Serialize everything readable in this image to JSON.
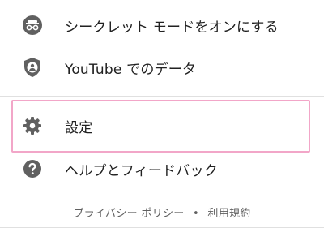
{
  "menu": {
    "items": [
      {
        "label": "シークレット モードをオンにする",
        "icon": "incognito-icon"
      },
      {
        "label": "YouTube でのデータ",
        "icon": "shield-person-icon"
      },
      {
        "label": "設定",
        "icon": "gear-icon"
      },
      {
        "label": "ヘルプとフィードバック",
        "icon": "help-icon"
      }
    ]
  },
  "footer": {
    "privacy_label": "プライバシー ポリシー",
    "separator": "•",
    "terms_label": "利用規約"
  },
  "colors": {
    "icon": "#606060",
    "highlight": "#f2a6c8"
  }
}
